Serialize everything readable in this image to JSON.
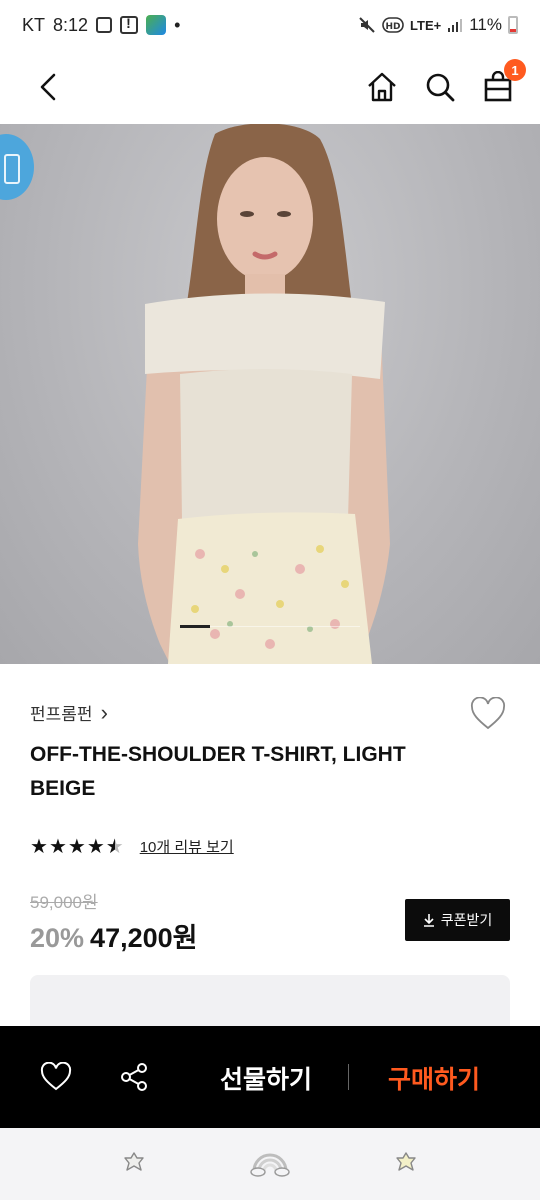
{
  "status_bar": {
    "carrier": "KT",
    "time": "8:12",
    "dot": "•",
    "network": "LTE+",
    "battery": "11%"
  },
  "header": {
    "cart_count": "1"
  },
  "product": {
    "brand": "펀프롬펀",
    "brand_chevron": "›",
    "title": "OFF-THE-SHOULDER T-SHIRT, LIGHT BEIGE",
    "rating": 4.5,
    "stars": [
      "★",
      "★",
      "★",
      "★",
      "★"
    ],
    "review_link": "10개 리뷰 보기",
    "original_price": "59,000원",
    "discount": "20%",
    "price": "47,200원",
    "coupon_label": "쿠폰받기"
  },
  "action_bar": {
    "gift_label": "선물하기",
    "buy_label": "구매하기"
  },
  "colors": {
    "accent": "#ff5a1f",
    "action_bar_bg": "#000000",
    "floating_button": "#4da6dc"
  },
  "icons": {
    "back": "chevron-left-icon",
    "home": "home-icon",
    "search": "search-icon",
    "cart": "shopping-bag-icon",
    "wishlist": "heart-icon",
    "share": "share-icon",
    "download": "download-icon"
  }
}
